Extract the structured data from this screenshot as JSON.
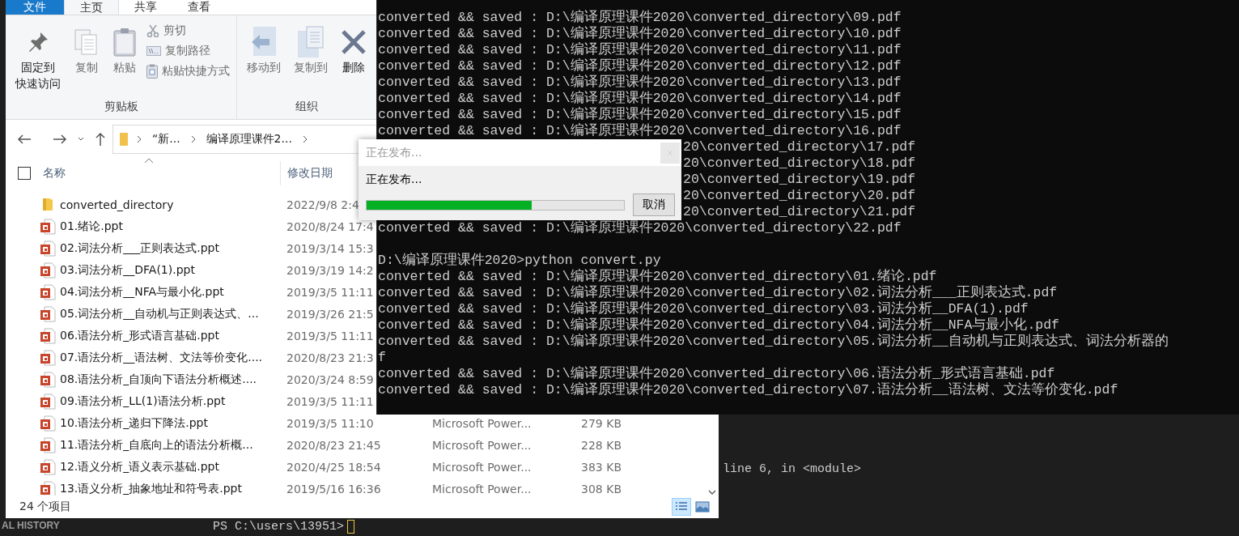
{
  "explorer": {
    "tabs": [
      {
        "label": "文件",
        "kind": "file",
        "selected": false
      },
      {
        "label": "主页",
        "kind": "tab",
        "selected": true
      },
      {
        "label": "共享",
        "kind": "tab",
        "selected": false
      },
      {
        "label": "查看",
        "kind": "tab",
        "selected": false
      }
    ],
    "ribbon": [
      {
        "label": "剪贴板",
        "items": [
          {
            "kind": "pin",
            "label_lines": [
              "固定到",
              "快速访问"
            ],
            "disabled": false
          },
          {
            "kind": "copy",
            "label_lines": [
              "复制"
            ],
            "disabled": true
          },
          {
            "kind": "paste",
            "label_lines": [
              "粘贴"
            ],
            "disabled": true
          },
          {
            "kind": "cut",
            "label_lines": [
              "剪切"
            ],
            "disabled": true
          },
          {
            "kind": "copy-path",
            "label_lines": [
              "复制路径"
            ],
            "disabled": true
          },
          {
            "kind": "paste-shortcut",
            "label_lines": [
              "粘贴快捷方式"
            ],
            "disabled": true
          }
        ]
      },
      {
        "label": "组织",
        "items": [
          {
            "kind": "move",
            "label_lines": [
              "移动到"
            ],
            "disabled": true
          },
          {
            "kind": "copy-to",
            "label_lines": [
              "复制到"
            ],
            "disabled": true
          },
          {
            "kind": "delete",
            "label_lines": [
              "删除"
            ],
            "disabled": false
          }
        ]
      }
    ],
    "select_all": {
      "checked": false
    },
    "breadcrumb": [
      "“新...",
      "编译原理课件2..."
    ],
    "columns": [
      "名称",
      "修改日期"
    ],
    "rows": [
      {
        "kind": "folder",
        "name": "converted_directory",
        "date": "2022/9/8 2:4"
      },
      {
        "kind": "ppt",
        "name": "01.绪论.ppt",
        "date": "2020/8/24 17:4"
      },
      {
        "kind": "ppt",
        "name": "02.词法分析___正则表达式.ppt",
        "date": "2019/3/14 15:3"
      },
      {
        "kind": "ppt",
        "name": "03.词法分析__DFA(1).ppt",
        "date": "2019/3/19 14:2"
      },
      {
        "kind": "ppt",
        "name": "04.词法分析__NFA与最小化.ppt",
        "date": "2019/3/5 11:11"
      },
      {
        "kind": "ppt",
        "name": "05.词法分析__自动机与正则表达式、...",
        "date": "2019/3/26 21:5"
      },
      {
        "kind": "ppt",
        "name": "06.语法分析_形式语言基础.ppt",
        "date": "2019/3/5 11:11"
      },
      {
        "kind": "ppt",
        "name": "07.语法分析__语法树、文法等价变化....",
        "date": "2020/8/23 21:3"
      },
      {
        "kind": "ppt",
        "name": "08.语法分析_自顶向下语法分析概述....",
        "date": "2020/3/24 8:59"
      },
      {
        "kind": "ppt",
        "name": "09.语法分析_LL(1)语法分析.ppt",
        "date": "2019/3/5 11:11"
      },
      {
        "kind": "ppt",
        "name": "10.语法分析_递归下降法.ppt",
        "date": "2019/3/5 11:10",
        "type": "Microsoft Power...",
        "size": "279 KB"
      },
      {
        "kind": "ppt",
        "name": "11.语法分析_自底向上的语法分析概...",
        "date": "2020/8/23 21:45",
        "type": "Microsoft Power...",
        "size": "228 KB"
      },
      {
        "kind": "ppt",
        "name": "12.语义分析_语义表示基础.ppt",
        "date": "2020/4/25 18:54",
        "type": "Microsoft Power...",
        "size": "383 KB"
      },
      {
        "kind": "ppt",
        "name": "13.语义分析_抽象地址和符号表.ppt",
        "date": "2019/5/16 16:36",
        "type": "Microsoft Power...",
        "size": "308 KB"
      }
    ],
    "status": "24 个项目",
    "views": [
      {
        "kind": "details",
        "selected": true
      },
      {
        "kind": "tiles",
        "selected": false
      }
    ]
  },
  "console": {
    "lines": [
      {
        "kind": "full",
        "text": "converted && saved : D:\\编译原理课件2020\\converted_directory\\09.pdf"
      },
      {
        "kind": "full",
        "text": "converted && saved : D:\\编译原理课件2020\\converted_directory\\10.pdf"
      },
      {
        "kind": "full",
        "text": "converted && saved : D:\\编译原理课件2020\\converted_directory\\11.pdf"
      },
      {
        "kind": "full",
        "text": "converted && saved : D:\\编译原理课件2020\\converted_directory\\12.pdf"
      },
      {
        "kind": "full",
        "text": "converted && saved : D:\\编译原理课件2020\\converted_directory\\13.pdf"
      },
      {
        "kind": "full",
        "text": "converted && saved : D:\\编译原理课件2020\\converted_directory\\14.pdf"
      },
      {
        "kind": "full",
        "text": "converted && saved : D:\\编译原理课件2020\\converted_directory\\15.pdf"
      },
      {
        "kind": "full",
        "text": "converted && saved : D:\\编译原理课件2020\\converted_directory\\16.pdf"
      },
      {
        "kind": "covered",
        "text": "20\\converted_directory\\17.pdf"
      },
      {
        "kind": "covered",
        "text": "20\\converted_directory\\18.pdf"
      },
      {
        "kind": "covered",
        "text": "20\\converted_directory\\19.pdf"
      },
      {
        "kind": "covered",
        "text": "20\\converted_directory\\20.pdf"
      },
      {
        "kind": "covered",
        "text": "20\\converted_directory\\21.pdf"
      },
      {
        "kind": "full",
        "text": "converted && saved : D:\\编译原理课件2020\\converted_directory\\22.pdf"
      },
      {
        "kind": "blank"
      },
      {
        "kind": "full",
        "text": "D:\\编译原理课件2020>python convert.py"
      },
      {
        "kind": "full",
        "text": "converted && saved : D:\\编译原理课件2020\\converted_directory\\01.绪论.pdf"
      },
      {
        "kind": "full",
        "text": "converted && saved : D:\\编译原理课件2020\\converted_directory\\02.词法分析___正则表达式.pdf"
      },
      {
        "kind": "full",
        "text": "converted && saved : D:\\编译原理课件2020\\converted_directory\\03.词法分析__DFA(1).pdf"
      },
      {
        "kind": "full",
        "text": "converted && saved : D:\\编译原理课件2020\\converted_directory\\04.词法分析__NFA与最小化.pdf"
      },
      {
        "kind": "full",
        "text": "converted && saved : D:\\编译原理课件2020\\converted_directory\\05.词法分析__自动机与正则表达式、词法分析器的"
      },
      {
        "kind": "full",
        "text": "f"
      },
      {
        "kind": "full",
        "text": "converted && saved : D:\\编译原理课件2020\\converted_directory\\06.语法分析_形式语言基础.pdf"
      },
      {
        "kind": "full",
        "text": "converted && saved : D:\\编译原理课件2020\\converted_directory\\07.语法分析__语法树、文法等价变化.pdf"
      }
    ]
  },
  "dialog": {
    "title": "正在发布...",
    "message": "正在发布...",
    "level": 0.64,
    "button": "取消"
  },
  "background": {
    "trace": "line 6, in <module>",
    "prompt": "PS C:\\users\\13951>",
    "panel": "AL HISTORY"
  }
}
